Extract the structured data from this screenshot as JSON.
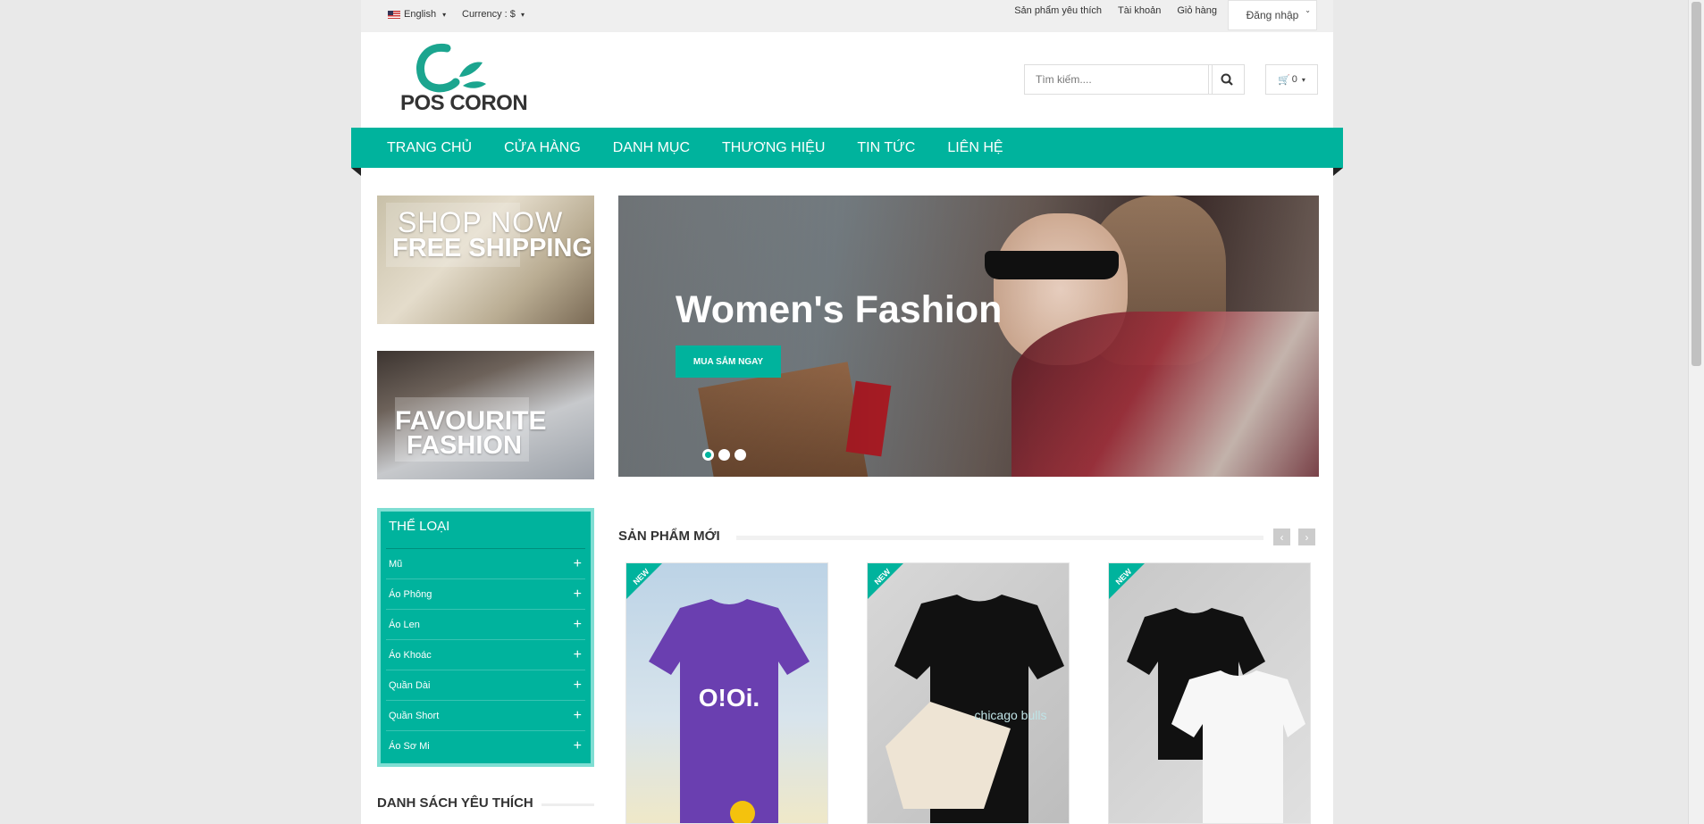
{
  "topbar": {
    "language": "English",
    "currency": "Currency : $",
    "links": [
      "Sản phẩm yêu thích",
      "Tài khoản",
      "Giỏ hàng"
    ],
    "login": "Đăng nhập"
  },
  "header": {
    "logo_text": "POS CORON",
    "search_placeholder": "Tìm kiếm....",
    "cart_count": "0"
  },
  "nav": [
    "TRANG CHỦ",
    "CỬA HÀNG",
    "DANH MỤC",
    "THƯƠNG HIỆU",
    "TIN TỨC",
    "LIÊN HỆ"
  ],
  "banners": {
    "left1_line1": "SHOP NOW",
    "left1_line2": "FREE SHIPPING",
    "left2_line1": "FAVOURITE",
    "left2_line2": "FASHION"
  },
  "hero": {
    "title": "Women's Fashion",
    "button": "MUA SẮM NGAY",
    "active_slide": 1,
    "slide_count": 3
  },
  "categories": {
    "title": "THỂ LOẠI",
    "items": [
      "Mũ",
      "Áo Phông",
      "Áo Len",
      "Áo Khoác",
      "Quần Dài",
      "Quần Short",
      "Áo Sơ Mi"
    ]
  },
  "wishlist_title": "DANH SÁCH YÊU THÍCH",
  "new_products": {
    "title": "SẢN PHẨM MỚI",
    "badge": "NEW",
    "product1_print": "O!Oi.",
    "product2_print": "chicago bulls"
  },
  "colors": {
    "accent": "#00b39d",
    "accent_border": "#7fded3"
  }
}
